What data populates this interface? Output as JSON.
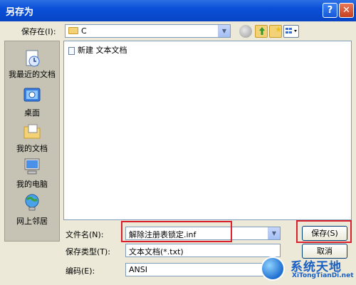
{
  "window": {
    "title": "另存为",
    "help_glyph": "?",
    "close_glyph": "✕"
  },
  "lookin": {
    "label": "保存在(I):",
    "value": "C"
  },
  "toolbar": {
    "icons": [
      "back-icon",
      "up-folder-icon",
      "new-folder-icon",
      "views-menu-icon"
    ]
  },
  "places": [
    {
      "label": "我最近的文档",
      "icon": "recent-documents-icon"
    },
    {
      "label": "桌面",
      "icon": "desktop-icon"
    },
    {
      "label": "我的文档",
      "icon": "my-documents-icon"
    },
    {
      "label": "我的电脑",
      "icon": "my-computer-icon"
    },
    {
      "label": "网上邻居",
      "icon": "network-places-icon"
    }
  ],
  "files": [
    {
      "name": "新建 文本文档",
      "icon": "text-file-icon"
    }
  ],
  "filename": {
    "label": "文件名(N):",
    "value": "解除注册表锁定.inf"
  },
  "filetype": {
    "label": "保存类型(T):",
    "value": "文本文档(*.txt)"
  },
  "encoding": {
    "label": "编码(E):",
    "value": "ANSI"
  },
  "buttons": {
    "save": "保存(S)",
    "cancel": "取消"
  },
  "watermark": {
    "title": "系统天地",
    "url": "XiTongTianDi.net"
  },
  "colors": {
    "highlight": "#d9202b",
    "titlebar": "#0a4fd8"
  }
}
